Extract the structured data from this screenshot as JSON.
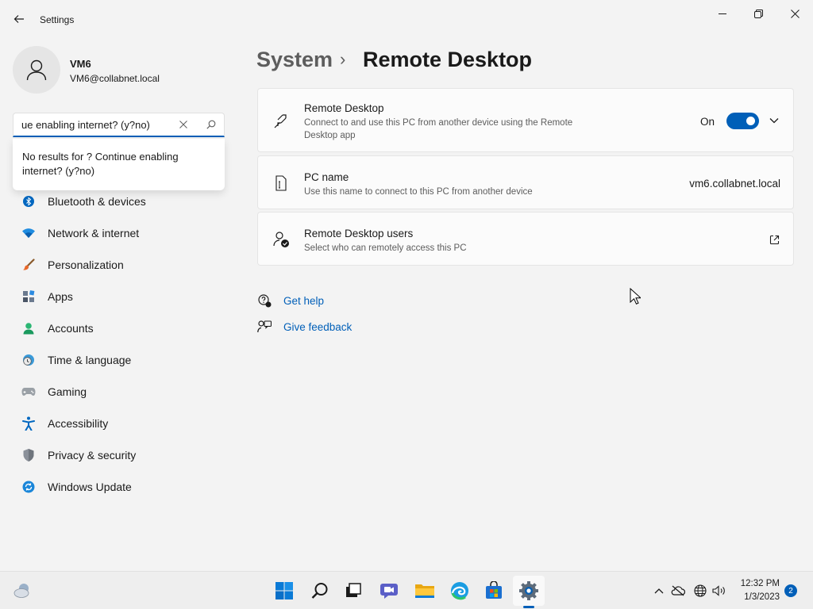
{
  "window": {
    "title": "Settings",
    "controls": {
      "minimize_icon": "minimize-icon",
      "maximize_icon": "restore-icon",
      "close_icon": "close-icon"
    }
  },
  "profile": {
    "name": "VM6",
    "email": "VM6@collabnet.local"
  },
  "search": {
    "value": "ue enabling internet? (y?no)",
    "no_results": "No results for ? Continue enabling internet? (y?no)"
  },
  "nav": {
    "items": [
      {
        "label": "Bluetooth & devices",
        "icon": "bluetooth-icon"
      },
      {
        "label": "Network & internet",
        "icon": "wifi-icon"
      },
      {
        "label": "Personalization",
        "icon": "brush-icon"
      },
      {
        "label": "Apps",
        "icon": "apps-icon"
      },
      {
        "label": "Accounts",
        "icon": "person-icon"
      },
      {
        "label": "Time & language",
        "icon": "clock-globe-icon"
      },
      {
        "label": "Gaming",
        "icon": "gamepad-icon"
      },
      {
        "label": "Accessibility",
        "icon": "accessibility-icon"
      },
      {
        "label": "Privacy & security",
        "icon": "shield-icon"
      },
      {
        "label": "Windows Update",
        "icon": "update-icon"
      }
    ]
  },
  "header": {
    "parent": "System",
    "separator": "›",
    "current": "Remote Desktop"
  },
  "cards": {
    "remote_desktop": {
      "title": "Remote Desktop",
      "description": "Connect to and use this PC from another device using the Remote Desktop app",
      "toggle_label": "On",
      "toggle_on": true
    },
    "pc_name": {
      "title": "PC name",
      "description": "Use this name to connect to this PC from another device",
      "value": "vm6.collabnet.local"
    },
    "users": {
      "title": "Remote Desktop users",
      "description": "Select who can remotely access this PC"
    }
  },
  "help": {
    "get_help": "Get help",
    "give_feedback": "Give feedback"
  },
  "taskbar": {
    "time": "12:32 PM",
    "date": "1/3/2023",
    "notifications": "2",
    "apps": [
      "start-icon",
      "search-icon",
      "task-view-icon",
      "chat-icon",
      "file-explorer-icon",
      "edge-icon",
      "store-icon",
      "settings-icon"
    ]
  },
  "colors": {
    "accent": "#005fb8",
    "background": "#f3f3f3",
    "card": "#fbfbfb"
  }
}
